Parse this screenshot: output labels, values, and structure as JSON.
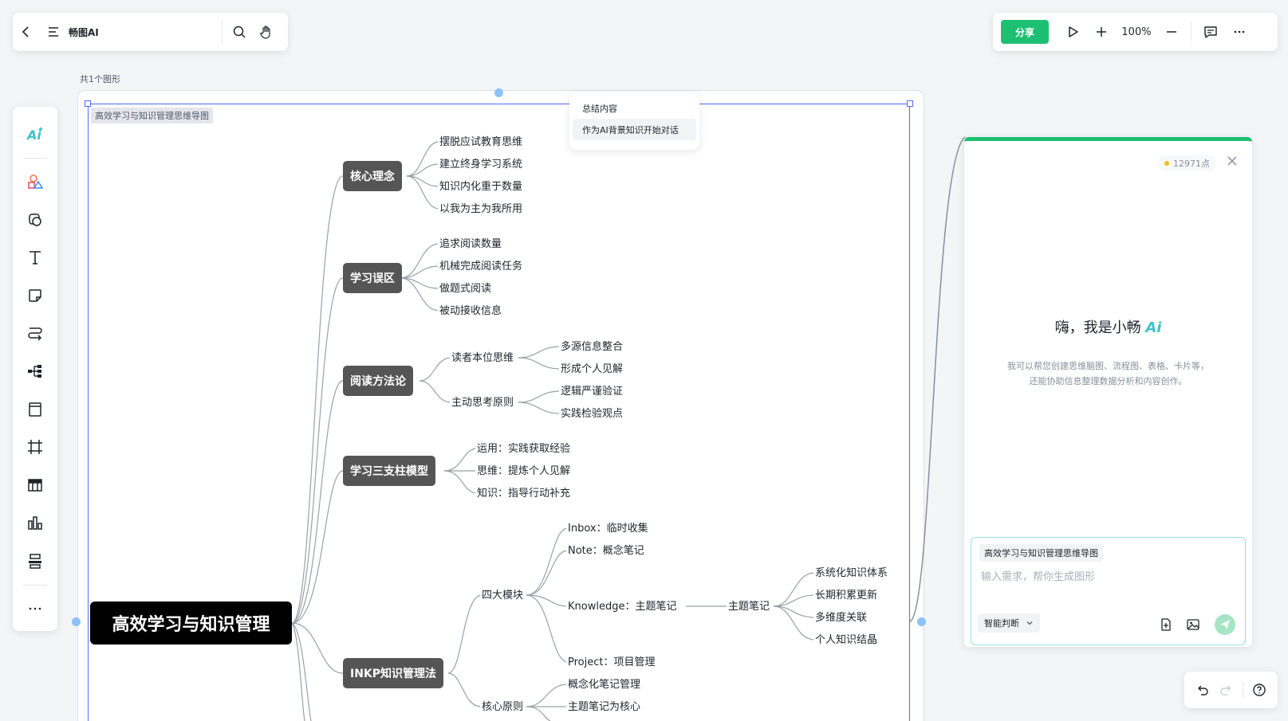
{
  "header": {
    "app_title": "畅图AI",
    "icons": [
      "back-icon",
      "menu-icon",
      "search-icon",
      "hand-icon"
    ]
  },
  "toolbar": {
    "share_label": "分享",
    "zoom": "100%",
    "icons": [
      "play-icon",
      "zoom-in-icon",
      "zoom-out-icon",
      "comment-icon",
      "more-icon"
    ]
  },
  "left_tools": [
    "ai-icon",
    "shapes-icon",
    "sticker-icon",
    "text-icon",
    "note-icon",
    "connector-icon",
    "mindmap-icon",
    "frame-icon",
    "crop-icon",
    "table-icon",
    "chart-icon",
    "align-icon",
    "more-icon"
  ],
  "canvas": {
    "shape_count": "共1个图形",
    "map_tag": "高效学习与知识管理思维导图"
  },
  "popup": {
    "items": [
      "总结内容",
      "作为AI背景知识开始对话"
    ]
  },
  "mindmap": {
    "root": "高效学习与知识管理",
    "branches": [
      {
        "label": "核心理念",
        "leaves": [
          "摆脱应试教育思维",
          "建立终身学习系统",
          "知识内化重于数量",
          "以我为主为我所用"
        ]
      },
      {
        "label": "学习误区",
        "leaves": [
          "追求阅读数量",
          "机械完成阅读任务",
          "做题式阅读",
          "被动接收信息"
        ]
      },
      {
        "label": "阅读方法论",
        "subs": [
          {
            "label": "读者本位思维",
            "leaves": [
              "多源信息整合",
              "形成个人见解"
            ]
          },
          {
            "label": "主动思考原则",
            "leaves": [
              "逻辑严谨验证",
              "实践检验观点"
            ]
          }
        ]
      },
      {
        "label": "学习三支柱模型",
        "leaves": [
          "运用：实践获取经验",
          "思维：提炼个人见解",
          "知识：指导行动补充"
        ]
      },
      {
        "label": "INKP知识管理法",
        "subs": [
          {
            "label": "四大模块",
            "leaves": [
              "Inbox：临时收集",
              "Note：概念笔记",
              "Knowledge：主题笔记",
              "Project：项目管理"
            ]
          },
          {
            "label": "主题笔记",
            "leaves": [
              "系统化知识体系",
              "长期积累更新",
              "多维度关联",
              "个人知识结晶"
            ]
          },
          {
            "label": "核心原则",
            "leaves": [
              "概念化笔记管理",
              "主题笔记为核心"
            ]
          }
        ]
      }
    ]
  },
  "ai_panel": {
    "points": "12971点",
    "greeting": "嗨，我是小畅",
    "greeting_ai": "Ai",
    "desc_line1": "我可以帮您创建思维脑图、流程图、表格、卡片等，",
    "desc_line2": "还能协助信息整理数据分析和内容创作。",
    "context_chip": "高效学习与知识管理思维导图",
    "input_placeholder": "输入需求，帮你生成图形",
    "mode": "智能判断"
  },
  "colors": {
    "accent": "#1dbf73",
    "selection": "#4c6ef5",
    "node_bg": "#555555",
    "root_bg": "#000000",
    "ai_brand": "#3ec3c9"
  }
}
